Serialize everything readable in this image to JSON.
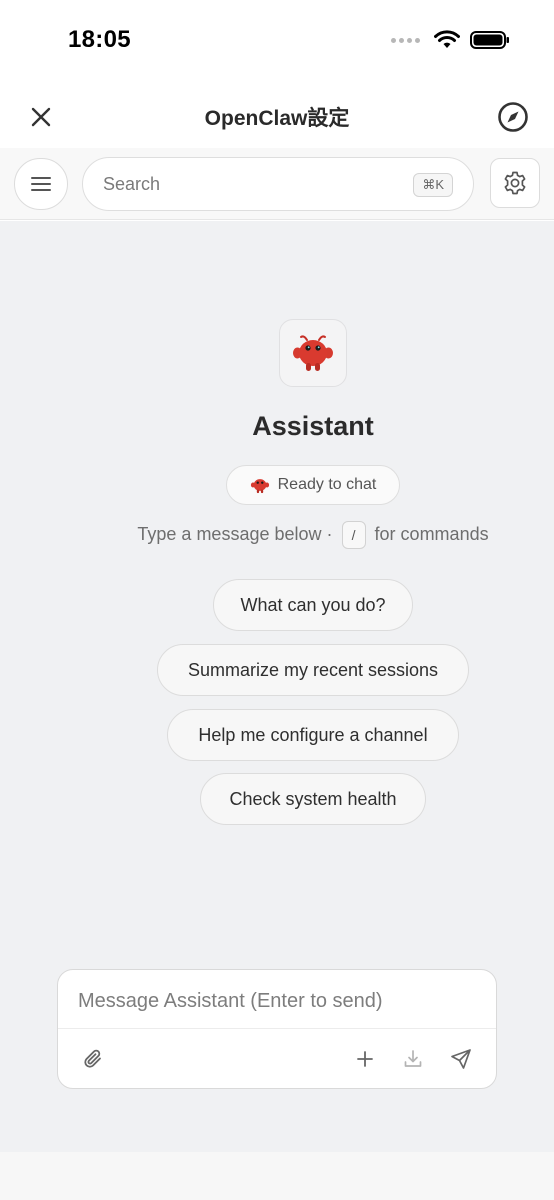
{
  "status_bar": {
    "time": "18:05"
  },
  "nav": {
    "title": "OpenClaw設定"
  },
  "toolbar": {
    "search_placeholder": "Search",
    "shortcut": "⌘K"
  },
  "assistant": {
    "name": "Assistant",
    "status": "Ready to chat",
    "hint_prefix": "Type a message below ·",
    "hint_key": "/",
    "hint_suffix": "for commands"
  },
  "suggestions": [
    "What can you do?",
    "Summarize my recent sessions",
    "Help me configure a channel",
    "Check system health"
  ],
  "composer": {
    "placeholder": "Message Assistant (Enter to send)"
  },
  "colors": {
    "accent": "#d93a2f",
    "background": "#f0f1f3"
  },
  "icons": [
    "close-icon",
    "compass-icon",
    "menu-icon",
    "gear-icon",
    "crab-icon",
    "paperclip-icon",
    "plus-icon",
    "download-icon",
    "send-icon"
  ]
}
